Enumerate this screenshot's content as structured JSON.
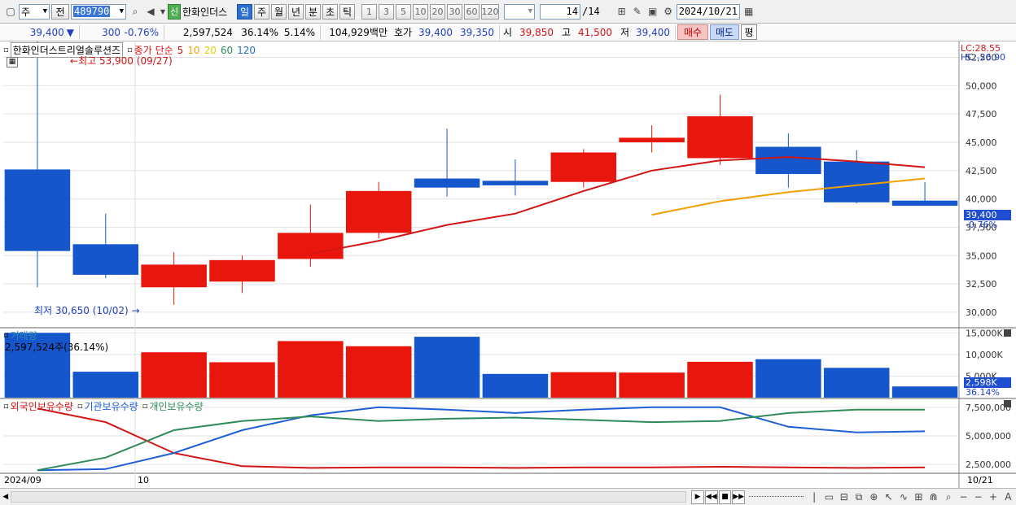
{
  "toolbar": {
    "type_option": "주",
    "prev_option": "전",
    "code": "489790",
    "stock_name": "한화인더스",
    "new_badge": "신",
    "periods": [
      "일",
      "주",
      "월",
      "년",
      "분",
      "초",
      "틱"
    ],
    "active_period": "일",
    "minutes": [
      "1",
      "3",
      "5",
      "10",
      "20",
      "30",
      "60",
      "120"
    ],
    "page_count": "14",
    "page_total": "/14",
    "date": "2024/10/21"
  },
  "infobar": {
    "price": "39,400",
    "change": "300",
    "change_pct": "-0.76%",
    "volume": "2,597,524",
    "vol_ratio": "36.14%",
    "turnover": "5.14%",
    "amount": "104,929백만",
    "ask_label": "호가",
    "ask": "39,400",
    "bid": "39,350",
    "open_label": "시",
    "open": "39,850",
    "high_label": "고",
    "high": "41,500",
    "low_label": "저",
    "low": "39,400",
    "buy": "매수",
    "sell": "매도",
    "eval": "평"
  },
  "price_panel": {
    "name": "한화인더스트리얼솔루션즈",
    "ma_label": "종가 단순",
    "ma_periods": [
      "5",
      "10",
      "20",
      "60",
      "120"
    ],
    "ma_colors": [
      "#d21414",
      "#f0a000",
      "#e8d000",
      "#2e8b57",
      "#1f6fbf"
    ],
    "high_note": "최고 53,900 (09/27)",
    "low_note": "최저 30,650 (10/02)",
    "lc": "LC:28.55",
    "hc": "HC:-26.90",
    "axis_ticks": [
      "52,500",
      "50,000",
      "47,500",
      "45,000",
      "42,500",
      "40,000",
      "37,500",
      "35,000",
      "32,500",
      "30,000"
    ],
    "current_price": "39,400",
    "current_pct": "-0.76%"
  },
  "volume_panel": {
    "title": "거래량",
    "value": "2,597,524주(36.14%)",
    "axis_ticks": [
      "15,000K",
      "10,000K",
      "5,000K"
    ],
    "current": "2,598K",
    "current_pct": "36.14%"
  },
  "holding_panel": {
    "legends": [
      "외국인보유수량",
      "기관보유수량",
      "개인보유수량"
    ],
    "colors": [
      "#d21414",
      "#1f5fd6",
      "#2e8b57"
    ],
    "axis_ticks": [
      "7,500,000",
      "5,000,000",
      "2,500,000"
    ]
  },
  "x_axis": {
    "start": "2024/09",
    "month": "10",
    "end": "10/21"
  },
  "chart_data": {
    "type": "candlestick",
    "candles": [
      {
        "o": 42600,
        "h": 53900,
        "l": 32200,
        "c": 35400
      },
      {
        "o": 36000,
        "h": 38700,
        "l": 33000,
        "c": 33300
      },
      {
        "o": 32200,
        "h": 35300,
        "l": 30650,
        "c": 34200
      },
      {
        "o": 32700,
        "h": 35000,
        "l": 31700,
        "c": 34600
      },
      {
        "o": 34700,
        "h": 39500,
        "l": 34000,
        "c": 37000
      },
      {
        "o": 37000,
        "h": 41500,
        "l": 36500,
        "c": 40700
      },
      {
        "o": 41800,
        "h": 46200,
        "l": 40200,
        "c": 41000
      },
      {
        "o": 41600,
        "h": 43500,
        "l": 40300,
        "c": 41200
      },
      {
        "o": 41500,
        "h": 44400,
        "l": 41000,
        "c": 44100
      },
      {
        "o": 45000,
        "h": 46500,
        "l": 44100,
        "c": 45400
      },
      {
        "o": 43600,
        "h": 49200,
        "l": 43000,
        "c": 47300
      },
      {
        "o": 44600,
        "h": 45800,
        "l": 41000,
        "c": 42200
      },
      {
        "o": 43300,
        "h": 44300,
        "l": 39600,
        "c": 39700
      },
      {
        "o": 39850,
        "h": 41500,
        "l": 39400,
        "c": 39400
      }
    ],
    "ma5": [
      null,
      null,
      null,
      null,
      35150,
      36300,
      37700,
      38700,
      40700,
      42500,
      43400,
      43700,
      43300,
      42800
    ],
    "ma10": [
      null,
      null,
      null,
      null,
      null,
      null,
      null,
      null,
      null,
      38600,
      39800,
      40600,
      41200,
      41800
    ],
    "volume": [
      15000,
      6000,
      10500,
      8200,
      13100,
      11900,
      14100,
      5500,
      5900,
      5800,
      8300,
      8900,
      6900,
      2598
    ],
    "foreign": [
      7400000,
      6200000,
      3500000,
      2350000,
      2200000,
      2250000,
      2250000,
      2200000,
      2250000,
      2250000,
      2300000,
      2250000,
      2200000,
      2250000
    ],
    "institution": [
      2000000,
      2100000,
      3500000,
      5500000,
      6800000,
      7500000,
      7300000,
      7000000,
      7300000,
      7500000,
      7500000,
      5800000,
      5300000,
      5400000
    ],
    "individual": [
      2000000,
      3100000,
      5500000,
      6300000,
      6700000,
      6300000,
      6500000,
      6600000,
      6400000,
      6200000,
      6300000,
      7000000,
      7300000,
      7300000
    ],
    "price_ylim": [
      28700,
      53900
    ],
    "volume_ylim": [
      0,
      16000
    ],
    "holding_ylim": [
      1800000,
      8200000
    ]
  }
}
